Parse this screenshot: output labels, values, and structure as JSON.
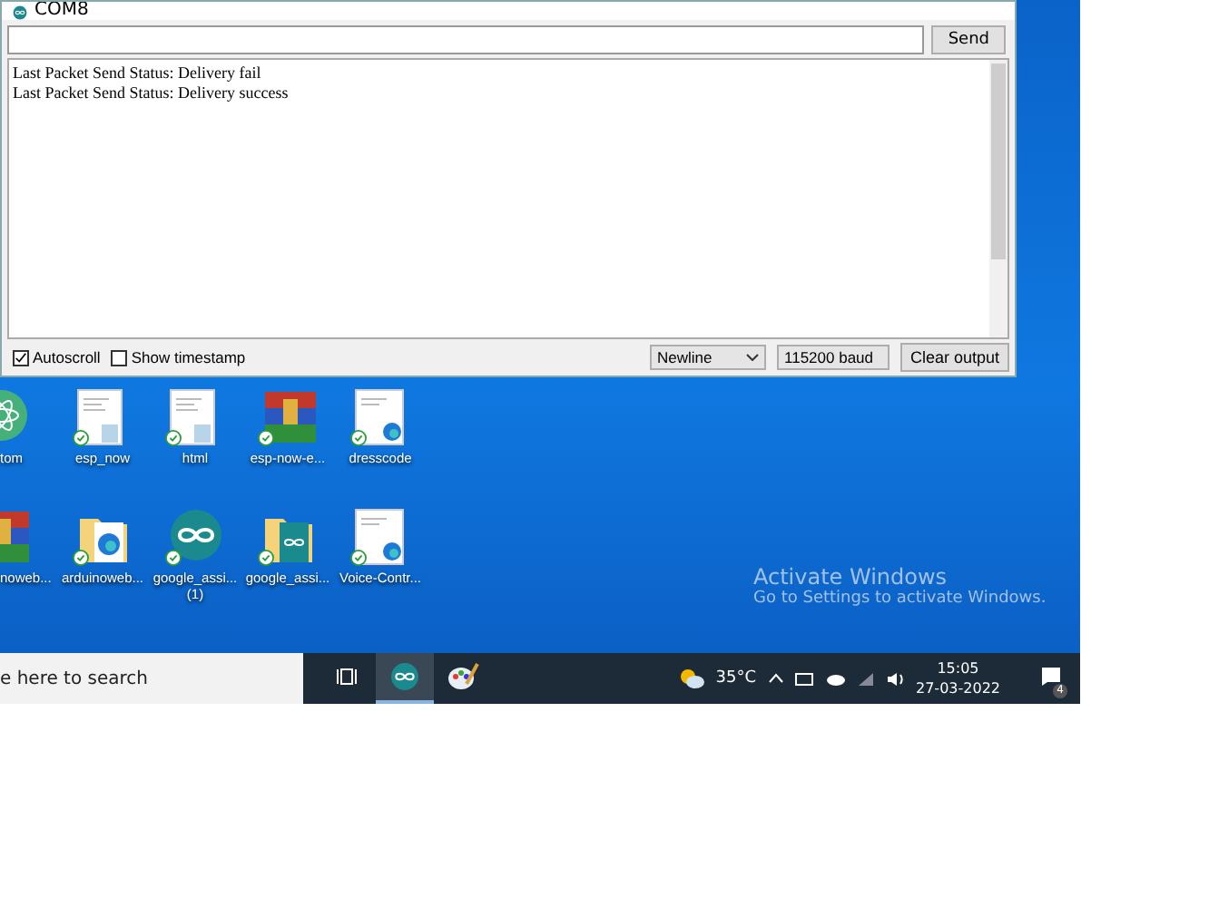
{
  "window": {
    "title": "COM8"
  },
  "send_button": "Send",
  "output_lines": [
    "Last Packet Send Status: Delivery fail",
    "Last Packet Send Status: Delivery success"
  ],
  "options": [
    {
      "label": "Autoscroll",
      "checked": true
    },
    {
      "label": "Show timestamp",
      "checked": false
    }
  ],
  "line_ending": "Newline",
  "baud_rate": "115200 baud",
  "clear_button": "Clear output",
  "desktop_icons": [
    {
      "label": "tom",
      "kind": "atom",
      "synced": false
    },
    {
      "label": "esp_now",
      "kind": "text-file",
      "synced": true
    },
    {
      "label": "html",
      "kind": "text-file",
      "synced": true
    },
    {
      "label": "esp-now-e...",
      "kind": "archive",
      "synced": true
    },
    {
      "label": "dresscode",
      "kind": "web-file",
      "synced": true
    },
    {
      "label": "noweb...",
      "kind": "archive",
      "synced": false
    },
    {
      "label": "arduinoweb...",
      "kind": "folder-web",
      "synced": true
    },
    {
      "label": "google_assi... (1)",
      "kind": "arduino",
      "synced": true
    },
    {
      "label": "google_assi...",
      "kind": "folder-arduino",
      "synced": true
    },
    {
      "label": "Voice-Contr...",
      "kind": "web-file",
      "synced": true
    }
  ],
  "activation": {
    "title": "Activate Windows",
    "message": "Go to Settings to activate Windows."
  },
  "taskbar": {
    "search_placeholder": "e here to search",
    "apps": [
      {
        "kind": "task-view",
        "selected": false
      },
      {
        "kind": "arduino",
        "selected": true
      },
      {
        "kind": "paint",
        "selected": false
      }
    ],
    "temperature": "35°C",
    "time": "15:05",
    "date": "27-03-2022",
    "notification_count": "4"
  }
}
